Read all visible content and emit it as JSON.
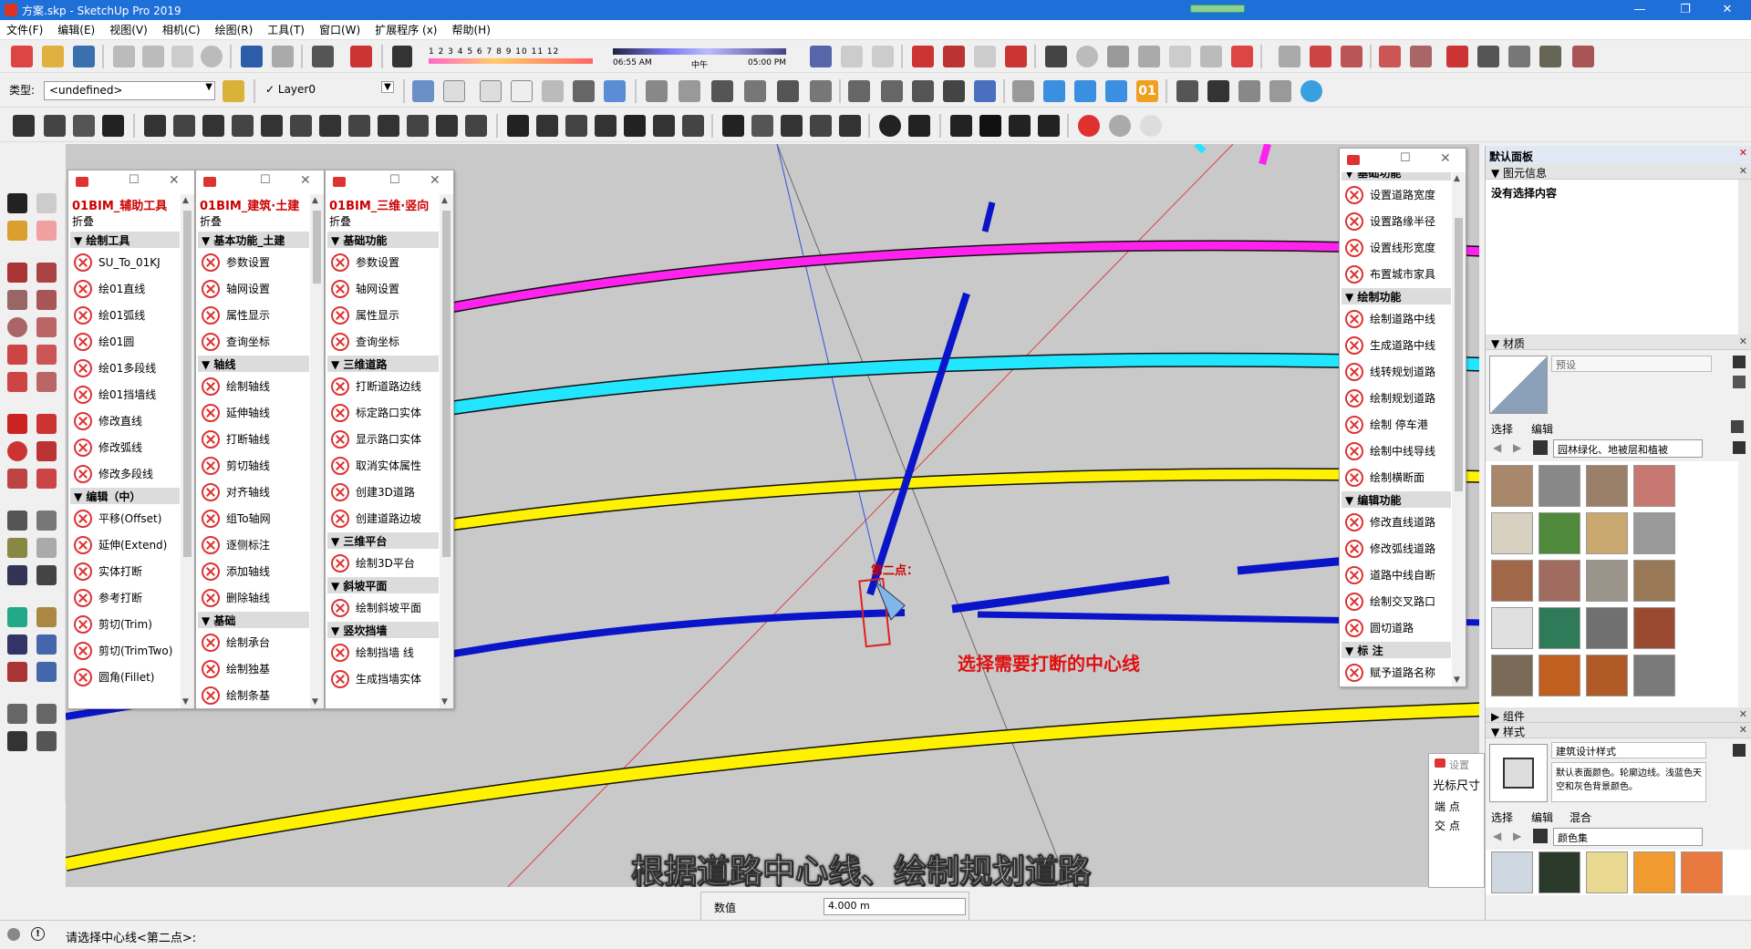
{
  "window": {
    "title": "方案.skp - SketchUp Pro 2019",
    "min": "—",
    "max": "❐",
    "close": "✕"
  },
  "menu": [
    "文件(F)",
    "编辑(E)",
    "视图(V)",
    "相机(C)",
    "绘图(R)",
    "工具(T)",
    "窗口(W)",
    "扩展程序 (x)",
    "帮助(H)"
  ],
  "toolbar": {
    "type_label": "类型:",
    "type_value": "<undefined>",
    "layer_check": "✓",
    "layer_value": "Layer0",
    "shadow_scale": "1 2 3 4 5 6 7 8 9 10 11 12",
    "time_start": "06:55 AM",
    "time_mid": "中午",
    "time_end": "05:00 PM",
    "ext_badge": "01"
  },
  "panel1": {
    "title": "01BIM_辅助工具",
    "fold": "折叠",
    "sections": [
      {
        "header": "▼ 绘制工具",
        "items": [
          "SU_To_01KJ",
          "绘01直线",
          "绘01弧线",
          "绘01圆",
          "绘01多段线",
          "绘01挡墙线",
          "修改直线",
          "修改弧线",
          "修改多段线"
        ]
      },
      {
        "header": "▼ 编辑（中）",
        "items": [
          "平移(Offset)",
          "延伸(Extend)",
          "实体打断",
          "参考打断",
          "剪切(Trim)",
          "剪切(TrimTwo)",
          "圆角(Fillet)"
        ]
      }
    ]
  },
  "panel2": {
    "title": "01BIM_建筑·土建",
    "fold": "折叠",
    "sections": [
      {
        "header": "▼ 基本功能_土建",
        "items": [
          "参数设置",
          "轴网设置",
          "属性显示",
          "查询坐标"
        ]
      },
      {
        "header": "▼ 轴线",
        "items": [
          "绘制轴线",
          "延伸轴线",
          "打断轴线",
          "剪切轴线",
          "对齐轴线",
          "组To轴网",
          "逐侧标注",
          "添加轴线",
          "删除轴线"
        ]
      },
      {
        "header": "▼ 基础",
        "items": [
          "绘制承台",
          "绘制独基",
          "绘制条基"
        ]
      }
    ]
  },
  "panel3": {
    "title": "01BIM_三维·竖向",
    "fold": "折叠",
    "sections": [
      {
        "header": "▼ 基础功能",
        "items": [
          "参数设置",
          "轴网设置",
          "属性显示",
          "查询坐标"
        ]
      },
      {
        "header": "▼ 三维道路",
        "items": [
          "打断道路边线",
          "标定路口实体",
          "显示路口实体",
          "取消实体属性",
          "创建3D道路",
          "创建道路边坡"
        ]
      },
      {
        "header": "▼ 三维平台",
        "items": [
          "绘制3D平台"
        ]
      },
      {
        "header": "▼ 斜坡平面",
        "items": [
          "绘制斜坡平面"
        ]
      },
      {
        "header": "▼ 竖坎挡墙",
        "items": [
          "绘制挡墙  线",
          "生成挡墙实体"
        ]
      }
    ]
  },
  "panel4": {
    "sections": [
      {
        "header": "▼ 基础功能",
        "items": [
          "设置道路宽度",
          "设置路缘半径",
          "设置线形宽度",
          "布置城市家具"
        ]
      },
      {
        "header": "▼ 绘制功能",
        "items": [
          "绘制道路中线",
          "生成道路中线",
          "线转规划道路",
          "绘制规划道路",
          "绘制  停车港",
          "绘制中线导线",
          "绘制横断面"
        ]
      },
      {
        "header": "▼ 编辑功能",
        "items": [
          "修改直线道路",
          "修改弧线道路",
          "道路中线自断",
          "绘制交叉路口",
          "圆切道路"
        ]
      },
      {
        "header": "▼ 标    注",
        "items": [
          "赋予道路名称"
        ]
      }
    ]
  },
  "viewport": {
    "point_label": "第二点：",
    "hint": "选择需要打断的中心线",
    "subtitle": "根据道路中心线、绘制规划道路"
  },
  "small_window": {
    "title": "设置",
    "line1": "光标尺寸",
    "line2": "端    点",
    "line3": "交    点"
  },
  "right_panel": {
    "title": "默认面板",
    "entity_info": "图元信息",
    "entity_value": "没有选择内容",
    "materials": "材质",
    "material_name": "预设",
    "tab_select": "选择",
    "tab_edit": "编辑",
    "material_collection": "园林绿化、地被层和植被",
    "components": "组件",
    "styles": "样式",
    "style_name": "建筑设计样式",
    "style_desc": "默认表面颜色。轮廓边线。浅蓝色天空和灰色背景颜色。",
    "style_tab_select": "选择",
    "style_tab_edit": "编辑",
    "style_tab_mix": "混合",
    "style_collection": "颜色集"
  },
  "measure": {
    "label": "数值",
    "value": "4.000 m"
  },
  "status": {
    "text": "请选择中心线<第二点>:"
  },
  "colors": {
    "magenta": "#ff22ee",
    "cyan": "#22e6ff",
    "yellow": "#fff200",
    "blue": "#0a14c8"
  }
}
